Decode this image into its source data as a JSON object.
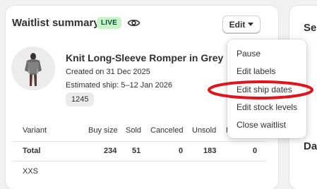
{
  "summary": {
    "title": "Waitlist summary",
    "status_badge": "LIVE",
    "edit_label": "Edit"
  },
  "product": {
    "name": "Knit Long-Sleeve Romper in Grey",
    "created": "Created on 31 Dec 2025",
    "estimated_ship": "Estimated ship: 5–12 Jan 2026",
    "tag": "1245"
  },
  "table": {
    "headers": [
      "Variant",
      "Buy size",
      "Sold",
      "Canceled",
      "Unsold",
      "E"
    ],
    "total_row": [
      "Total",
      "234",
      "51",
      "0",
      "183",
      "0"
    ],
    "first_variant": "XXS"
  },
  "menu": {
    "items": [
      "Pause",
      "Edit labels",
      "Edit ship dates",
      "Edit stock levels",
      "Close waitlist"
    ]
  },
  "side_card": {
    "title_partial": "Se",
    "label_partial": "Da"
  },
  "colors": {
    "badge_bg": "#c9f4c7",
    "badge_text": "#0c5132",
    "highlight_oval": "#e0141e"
  }
}
